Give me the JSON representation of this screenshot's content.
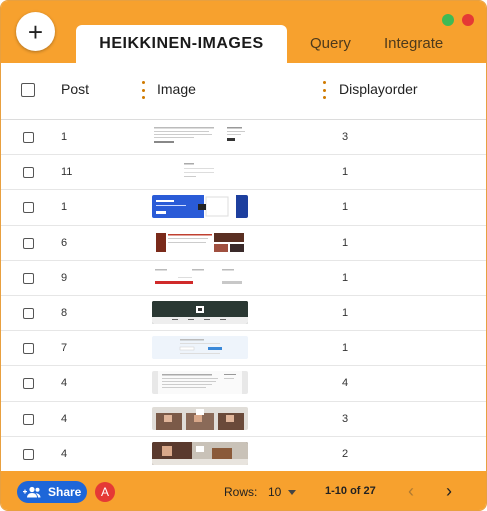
{
  "header": {
    "add_label": "+",
    "active_tab": "HEIKKINEN-IMAGES",
    "tabs": [
      "Query",
      "Integrate"
    ]
  },
  "columns": [
    "Post",
    "Image",
    "Displayorder"
  ],
  "rows": [
    {
      "post": "1",
      "order": "3",
      "thumb": "document-screenshot"
    },
    {
      "post": "11",
      "order": "1",
      "thumb": "white-form-screenshot"
    },
    {
      "post": "1",
      "order": "1",
      "thumb": "blue-banner-screenshot"
    },
    {
      "post": "6",
      "order": "1",
      "thumb": "red-collage-screenshot"
    },
    {
      "post": "9",
      "order": "1",
      "thumb": "white-form-red-button-screenshot"
    },
    {
      "post": "8",
      "order": "1",
      "thumb": "dark-banner-screenshot"
    },
    {
      "post": "7",
      "order": "1",
      "thumb": "light-blue-form-screenshot"
    },
    {
      "post": "4",
      "order": "4",
      "thumb": "grey-text-page-screenshot"
    },
    {
      "post": "4",
      "order": "3",
      "thumb": "portraits-screenshot"
    },
    {
      "post": "4",
      "order": "2",
      "thumb": "dark-photo-screenshot"
    }
  ],
  "footer": {
    "share_label": "Share",
    "avatar_letter": "A",
    "rows_label": "Rows:",
    "rows_value": "10",
    "range_label": "1-10 of 27"
  },
  "colors": {
    "accent": "#f7a12e",
    "share": "#1e66d8",
    "avatar": "#e53935"
  }
}
